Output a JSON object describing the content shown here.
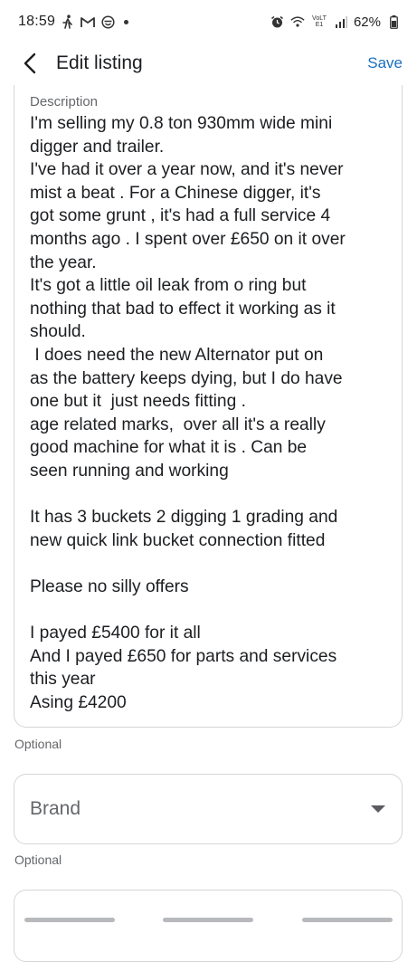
{
  "status_bar": {
    "time": "18:59",
    "left_icons": [
      "walking-icon",
      "gmail-icon",
      "emoji-icon"
    ],
    "right_icons": [
      "alarm-icon",
      "wifi-icon",
      "volte-icon",
      "signal-icon",
      "battery-icon"
    ],
    "volte_text": "VoLTE1",
    "battery": "62%"
  },
  "app_bar": {
    "title": "Edit listing",
    "save_label": "Save"
  },
  "description": {
    "label": "Description",
    "text": "I'm selling my 0.8 ton 930mm wide mini\ndigger and trailer.\nI've had it over a year now, and it's never\nmist a beat . For a Chinese digger, it's\ngot some grunt , it's had a full service 4\nmonths ago . I spent over £650 on it over\nthe year.\nIt's got a little oil leak from o ring but\nnothing that bad to effect it working as it\nshould.\n I does need the new Alternator put on\nas the battery keeps dying, but I do have\none but it  just needs fitting .\nage related marks,  over all it's a really\ngood machine for what it is . Can be\nseen running and working\n\nIt has 3 buckets 2 digging 1 grading and\nnew quick link bucket connection fitted\n\nPlease no silly offers\n\nI payed £5400 for it all\nAnd I payed £650 for parts and services\nthis year\nAsing £4200",
    "helper": "Optional"
  },
  "brand": {
    "label": "Brand",
    "helper": "Optional"
  },
  "colors": {
    "accent": "#1a6fbf",
    "border": "#d4d6da",
    "secondary_text": "#65676b"
  }
}
